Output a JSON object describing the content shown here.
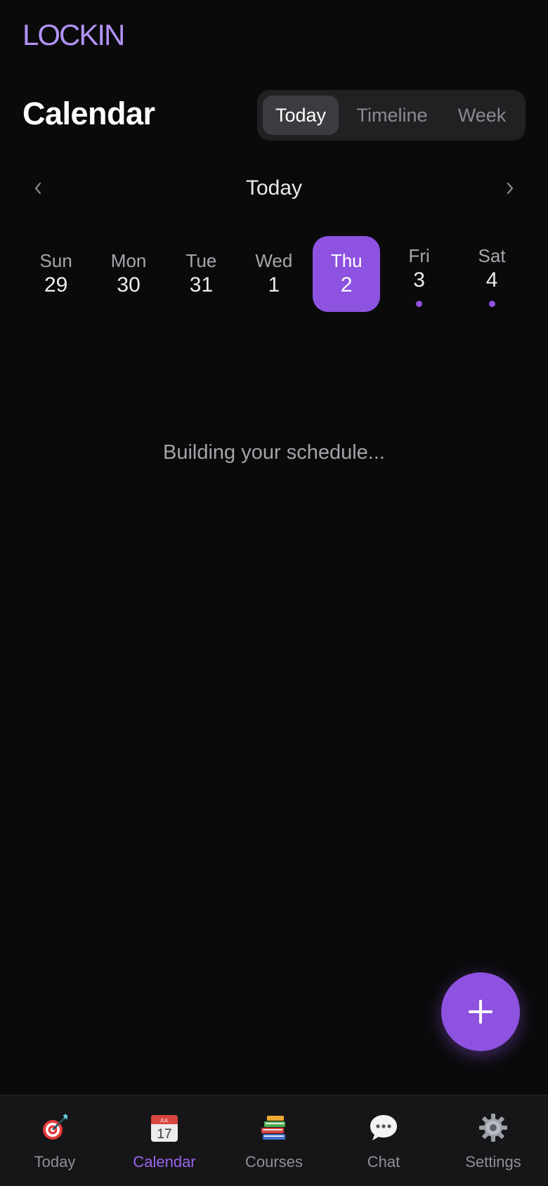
{
  "app": {
    "brand": "LOCKIN"
  },
  "header": {
    "title": "Calendar",
    "view_switch": [
      {
        "label": "Today",
        "active": true
      },
      {
        "label": "Timeline",
        "active": false
      },
      {
        "label": "Week",
        "active": false
      }
    ]
  },
  "date_nav": {
    "prev_icon": "chevron-left-icon",
    "label": "Today",
    "next_icon": "chevron-right-icon"
  },
  "week": {
    "days": [
      {
        "name": "Sun",
        "num": "29",
        "selected": false,
        "has_event": false
      },
      {
        "name": "Mon",
        "num": "30",
        "selected": false,
        "has_event": false
      },
      {
        "name": "Tue",
        "num": "31",
        "selected": false,
        "has_event": false
      },
      {
        "name": "Wed",
        "num": "1",
        "selected": false,
        "has_event": false
      },
      {
        "name": "Thu",
        "num": "2",
        "selected": true,
        "has_event": false
      },
      {
        "name": "Fri",
        "num": "3",
        "selected": false,
        "has_event": true
      },
      {
        "name": "Sat",
        "num": "4",
        "selected": false,
        "has_event": true
      }
    ]
  },
  "main": {
    "status": "Building your schedule..."
  },
  "fab": {
    "icon": "plus-icon"
  },
  "tabbar": {
    "tabs": [
      {
        "label": "Today",
        "icon": "target-icon",
        "active": false
      },
      {
        "label": "Calendar",
        "icon": "calendar-icon",
        "active": true
      },
      {
        "label": "Courses",
        "icon": "books-icon",
        "active": false
      },
      {
        "label": "Chat",
        "icon": "chat-bubble-icon",
        "active": false
      },
      {
        "label": "Settings",
        "icon": "gear-icon",
        "active": false
      }
    ]
  },
  "colors": {
    "accent": "#8d53e0",
    "brand": "#b292f5",
    "background": "#0a0a0b",
    "tabbar": "#161618"
  }
}
